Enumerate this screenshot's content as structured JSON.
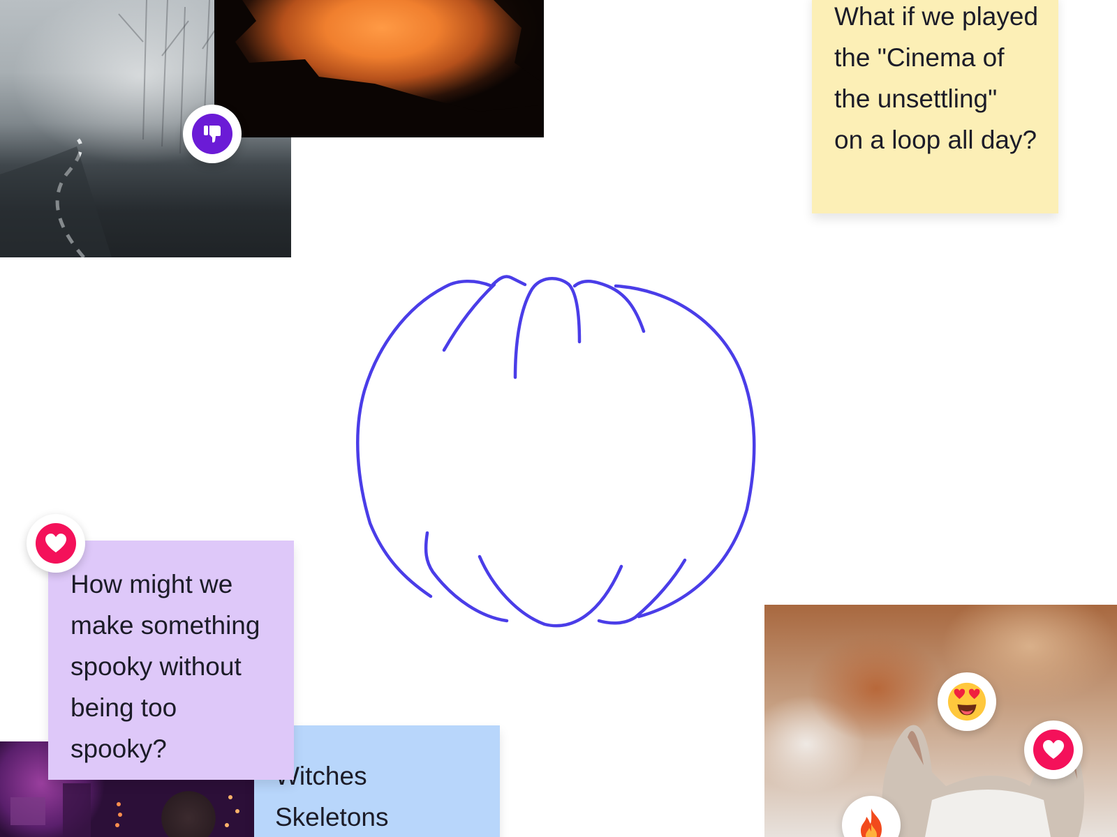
{
  "board": {
    "stickies": [
      {
        "id": "yellow",
        "text": "What if we played\nthe \"Cinema of\nthe unsettling\"\non a loop all day?",
        "color": "#fcefb6"
      },
      {
        "id": "purple",
        "text": "How might we\nmake something\nspooky without\nbeing too\nspooky?",
        "color": "#dec8f9"
      },
      {
        "id": "blue",
        "text": "Witches\nSkeletons",
        "color": "#b8d6fb"
      }
    ],
    "reactions": [
      {
        "icon": "thumbs-down-icon",
        "color": "#6b1bd6"
      },
      {
        "icon": "heart-icon",
        "color": "#f4115a"
      },
      {
        "icon": "heart-eyes-emoji-icon"
      },
      {
        "icon": "heart-icon",
        "color": "#f4115a"
      },
      {
        "icon": "fire-emoji-icon"
      }
    ],
    "photos": [
      {
        "icon": "foggy-road-photo"
      },
      {
        "icon": "orange-sunset-silhouette-photo"
      },
      {
        "icon": "purple-party-photo"
      },
      {
        "icon": "dog-costume-photo"
      }
    ],
    "drawing": {
      "icon": "pumpkin-sketch",
      "stroke_color": "#4a3de8"
    }
  }
}
